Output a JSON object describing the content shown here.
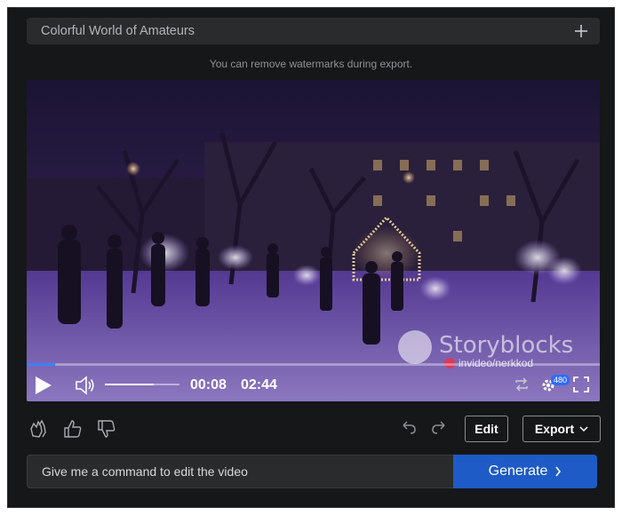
{
  "project": {
    "title": "Colorful World of Amateurs",
    "add_icon": "plus-icon"
  },
  "notice": "You can remove watermarks during export.",
  "player": {
    "watermark_brand": "Storyblocks",
    "watermark_credit": "invideo/nerkkod",
    "current_time": "00:08",
    "duration": "02:44",
    "progress": 0.05,
    "volume": 0.65,
    "quality": "480",
    "icons": [
      "play-icon",
      "volume-icon",
      "loop-icon",
      "settings-icon",
      "fullscreen-icon"
    ]
  },
  "actions": {
    "icons": [
      "clap-icon",
      "thumbs-up-icon",
      "thumbs-down-icon",
      "undo-icon",
      "redo-icon"
    ],
    "edit_label": "Edit",
    "export_label": "Export"
  },
  "command": {
    "placeholder": "Give me a command to edit the video",
    "generate_label": "Generate"
  },
  "colors": {
    "background": "#161718",
    "accent": "#1e5bc6",
    "progress": "#3d7fff"
  }
}
